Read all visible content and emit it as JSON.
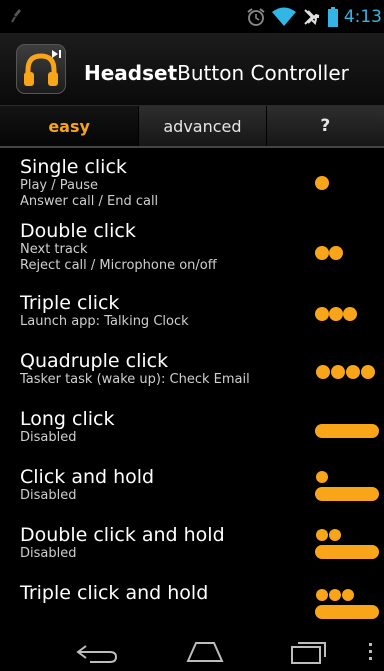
{
  "status_bar": {
    "time": "4:13",
    "icons": [
      "usb-icon",
      "alarm-icon",
      "wifi-icon",
      "airplane-mode-icon",
      "battery-icon"
    ]
  },
  "app": {
    "title_bold": "Headset",
    "title_rest": "Button Controller",
    "icon": "headset-icon"
  },
  "tabs": [
    {
      "label": "easy",
      "active": true
    },
    {
      "label": "advanced",
      "active": false
    },
    {
      "label": "?",
      "active": false
    }
  ],
  "actions": [
    {
      "title": "Single click",
      "lines": [
        "Play / Pause",
        "Answer call / End call"
      ],
      "icon": "single-click-icon"
    },
    {
      "title": "Double click",
      "lines": [
        "Next track",
        "Reject call / Microphone on/off"
      ],
      "icon": "double-click-icon"
    },
    {
      "title": "Triple click",
      "lines": [
        "Launch app: Talking Clock"
      ],
      "icon": "triple-click-icon"
    },
    {
      "title": "Quadruple click",
      "lines": [
        "Tasker task (wake up): Check Email"
      ],
      "icon": "quadruple-click-icon"
    },
    {
      "title": "Long click",
      "lines": [
        "Disabled"
      ],
      "icon": "long-click-icon"
    },
    {
      "title": "Click and hold",
      "lines": [
        "Disabled"
      ],
      "icon": "click-and-hold-icon"
    },
    {
      "title": "Double click and hold",
      "lines": [
        "Disabled"
      ],
      "icon": "double-click-and-hold-icon"
    },
    {
      "title": "Triple click and hold",
      "lines": [],
      "icon": "triple-click-and-hold-icon"
    }
  ],
  "nav_bar": {
    "icons": [
      "back-icon",
      "home-icon",
      "recent-apps-icon",
      "overflow-menu-icon"
    ]
  },
  "colors": {
    "accent": "#f9a51a",
    "clock": "#33b5e5",
    "background": "#000000"
  }
}
